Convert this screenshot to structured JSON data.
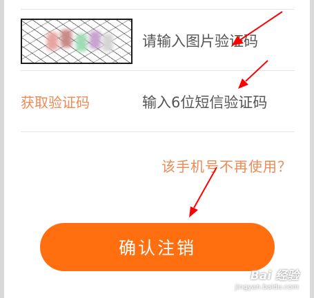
{
  "captcha": {
    "placeholder": "请输入图片验证码"
  },
  "sms": {
    "get_code_label": "获取验证码",
    "placeholder": "输入6位短信验证码"
  },
  "stop_using_link": "该手机号不再使用？",
  "confirm_button": "确认注销",
  "colors": {
    "accent": "#ec8a55",
    "button": "#ff6e0f",
    "annotation_arrow": "#ff0000"
  },
  "watermark": {
    "logo": "Bai 经验",
    "url": "jingyan.baidu.com"
  }
}
